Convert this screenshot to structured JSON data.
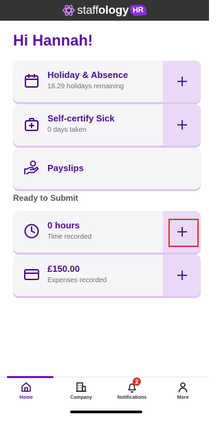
{
  "brand": {
    "prefix": "staff",
    "bold": "ology",
    "badge": "HR",
    "logo_icon": "atom-logo"
  },
  "greeting": "Hi Hannah!",
  "cards": {
    "holiday": {
      "title": "Holiday & Absence",
      "subtitle": "18.29 holidays remaining",
      "icon": "calendar-icon"
    },
    "sick": {
      "title": "Self-certify Sick",
      "subtitle": "0 days taken",
      "icon": "medical-bag-icon"
    },
    "payslips": {
      "title": "Payslips",
      "icon": "hand-money-icon"
    }
  },
  "section_label": "Ready to Submit",
  "submit": {
    "hours": {
      "title": "0 hours",
      "subtitle": "Time recorded",
      "icon": "clock-icon"
    },
    "expenses": {
      "title": "£150.00",
      "subtitle": "Expenses recorded",
      "icon": "card-icon"
    }
  },
  "tabs": {
    "home": {
      "label": "Home",
      "icon": "home-icon"
    },
    "company": {
      "label": "Company",
      "icon": "building-icon"
    },
    "notifications": {
      "label": "Notifications",
      "icon": "bell-icon",
      "badge": "2"
    },
    "more": {
      "label": "More",
      "icon": "person-icon"
    }
  },
  "colors": {
    "primary": "#5b12a0",
    "accent_bg": "#ead9f7",
    "card_bg": "#f5f4f7",
    "badge": "#e03a2f",
    "topbar": "#343434"
  }
}
